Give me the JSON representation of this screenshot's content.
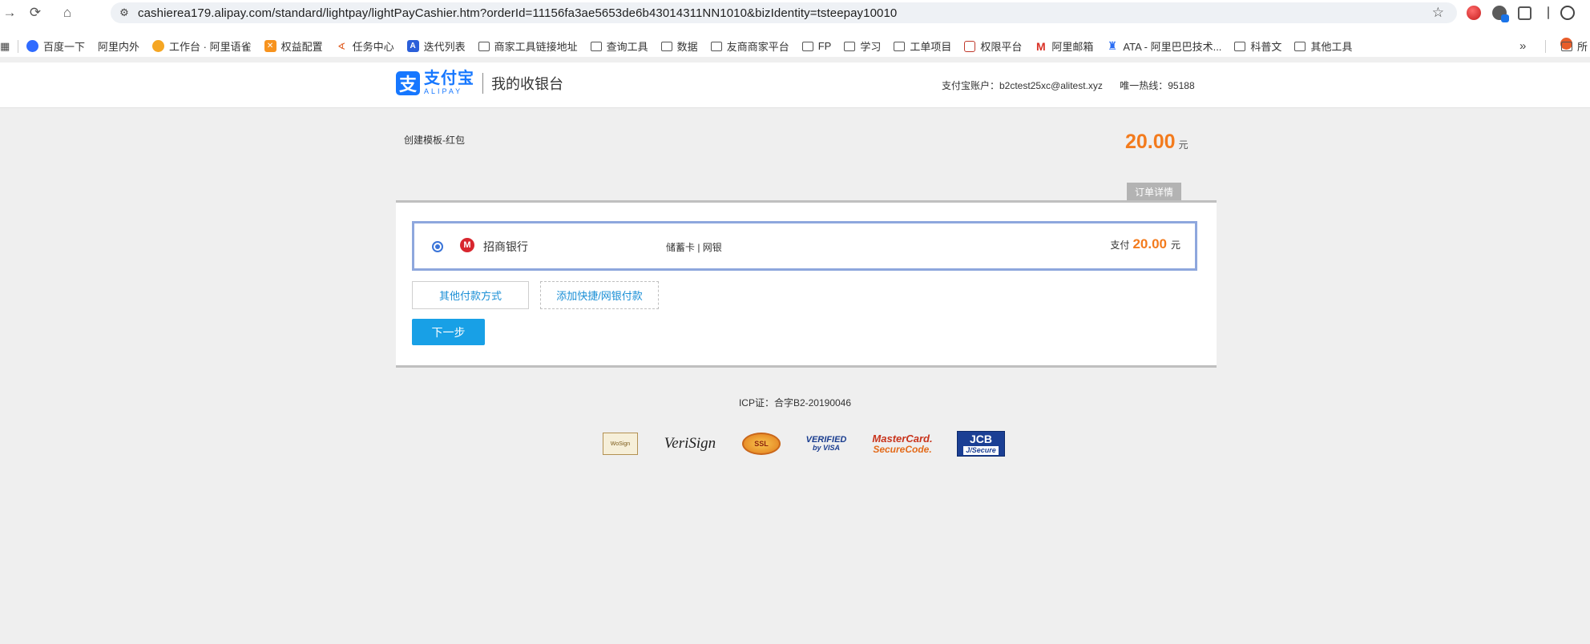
{
  "browser": {
    "url": "cashierea179.alipay.com/standard/lightpay/lightPayCashier.htm?orderId=11156fa3ae5653de6b43014311NN1010&bizIdentity=tsteepay10010",
    "bookmarks": [
      {
        "label": "百度一下",
        "icon": "paw-icon"
      },
      {
        "label": "阿里内外",
        "icon": "star-icon"
      },
      {
        "label": "工作台 · 阿里语雀",
        "icon": "hand-icon"
      },
      {
        "label": "权益配置",
        "icon": "orange-icon"
      },
      {
        "label": "任务中心",
        "icon": "task-icon"
      },
      {
        "label": "迭代列表",
        "icon": "a-icon"
      },
      {
        "label": "商家工具链接地址",
        "icon": "folder-icon"
      },
      {
        "label": "查询工具",
        "icon": "folder-icon"
      },
      {
        "label": "数据",
        "icon": "folder-icon"
      },
      {
        "label": "友商商家平台",
        "icon": "folder-icon"
      },
      {
        "label": "FP",
        "icon": "folder-icon"
      },
      {
        "label": "学习",
        "icon": "folder-icon"
      },
      {
        "label": "工单项目",
        "icon": "folder-icon"
      },
      {
        "label": "权限平台",
        "icon": "lock-icon"
      },
      {
        "label": "阿里邮箱",
        "icon": "mail-icon"
      },
      {
        "label": "ATA - 阿里巴巴技术...",
        "icon": "ata-icon"
      },
      {
        "label": "科普文",
        "icon": "folder-icon"
      },
      {
        "label": "其他工具",
        "icon": "folder-icon"
      }
    ],
    "bookmark_overflow": "»",
    "bookmark_last": "所"
  },
  "header": {
    "logo_cn": "支付宝",
    "logo_en": "ALIPAY",
    "logo_glyph": "支",
    "title": "我的收银台",
    "account_label": "支付宝账户：b2ctest25xc@alitest.xyz",
    "hotline_label": "唯一热线：95188"
  },
  "order": {
    "name": "创建模板-红包",
    "amount": "20.00",
    "unit": "元",
    "detail_label": "订单详情"
  },
  "payment": {
    "bank_name": "招商银行",
    "bank_glyph": "M",
    "card_type": "储蓄卡 | 网银",
    "pay_label": "支付",
    "pay_amount": "20.00",
    "pay_unit": "元",
    "other_methods_label": "其他付款方式",
    "add_method_label": "添加快捷/网银付款",
    "next_label": "下一步"
  },
  "footer": {
    "icp": "ICP证：合字B2-20190046",
    "certs": {
      "wosign": "WoSign",
      "verisign": "VeriSign",
      "ssl": "SSL",
      "visa_top": "VERIFIED",
      "visa_bottom": "by VISA",
      "mc_top": "MasterCard.",
      "mc_bottom": "SecureCode.",
      "jcb_top": "JCB",
      "jcb_bottom": "J/Secure"
    }
  }
}
